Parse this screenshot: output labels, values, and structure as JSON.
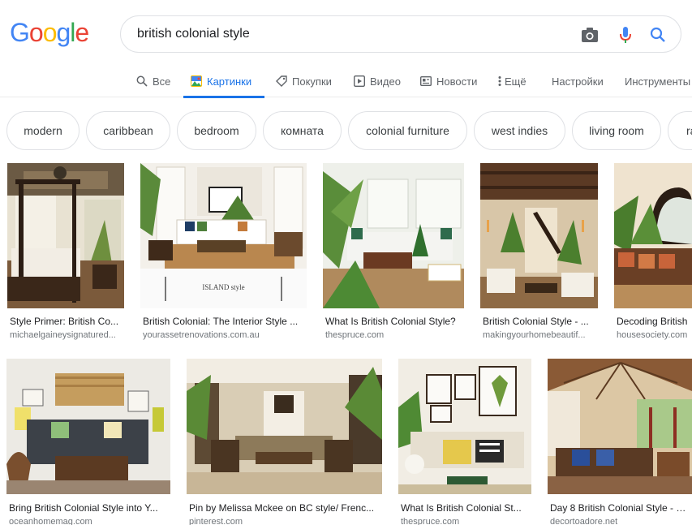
{
  "logo": {
    "letters": [
      "G",
      "o",
      "o",
      "g",
      "l",
      "e"
    ],
    "colors": [
      "#4285f4",
      "#ea4335",
      "#fbbc05",
      "#4285f4",
      "#34a853",
      "#ea4335"
    ]
  },
  "search": {
    "query": "british colonial style"
  },
  "icons": {
    "camera": "camera-icon",
    "mic": "microphone-icon",
    "search": "search-icon"
  },
  "tabs": [
    {
      "label": "Все",
      "icon": "search-icon"
    },
    {
      "label": "Картинки",
      "icon": "image-icon",
      "active": true
    },
    {
      "label": "Покупки",
      "icon": "tag-icon"
    },
    {
      "label": "Видео",
      "icon": "play-icon"
    },
    {
      "label": "Новости",
      "icon": "news-icon"
    },
    {
      "label": "Ещё",
      "icon": "more-vert-icon"
    },
    {
      "label": "Настройки"
    },
    {
      "label": "Инструменты"
    }
  ],
  "chips": [
    "modern",
    "caribbean",
    "bedroom",
    "комната",
    "colonial furniture",
    "west indies",
    "living room",
    "ra"
  ],
  "results": [
    {
      "title": "Style Primer: British Co...",
      "source": "michaelgaineysignatured..."
    },
    {
      "title": "British Colonial: The Interior Style ...",
      "source": "yourassetrenovations.com.au",
      "caption": "ISLAND style"
    },
    {
      "title": "What Is British Colonial Style?",
      "source": "thespruce.com"
    },
    {
      "title": "British Colonial Style - ...",
      "source": "makingyourhomebeautif..."
    },
    {
      "title": "Decoding British",
      "source": "housesociety.com"
    },
    {
      "title": "Bring British Colonial Style into Y...",
      "source": "oceanhomemag.com"
    },
    {
      "title": "Pin by Melissa Mckee on BC style/ Frenc...",
      "source": "pinterest.com"
    },
    {
      "title": "What Is British Colonial St...",
      "source": "thespruce.com"
    },
    {
      "title": "Day 8 British Colonial Style - Dec",
      "source": "decortoadore.net"
    }
  ],
  "colors": {
    "accent": "#1a73e8",
    "mic_blue": "#4285f4",
    "mic_red": "#ea4335"
  }
}
